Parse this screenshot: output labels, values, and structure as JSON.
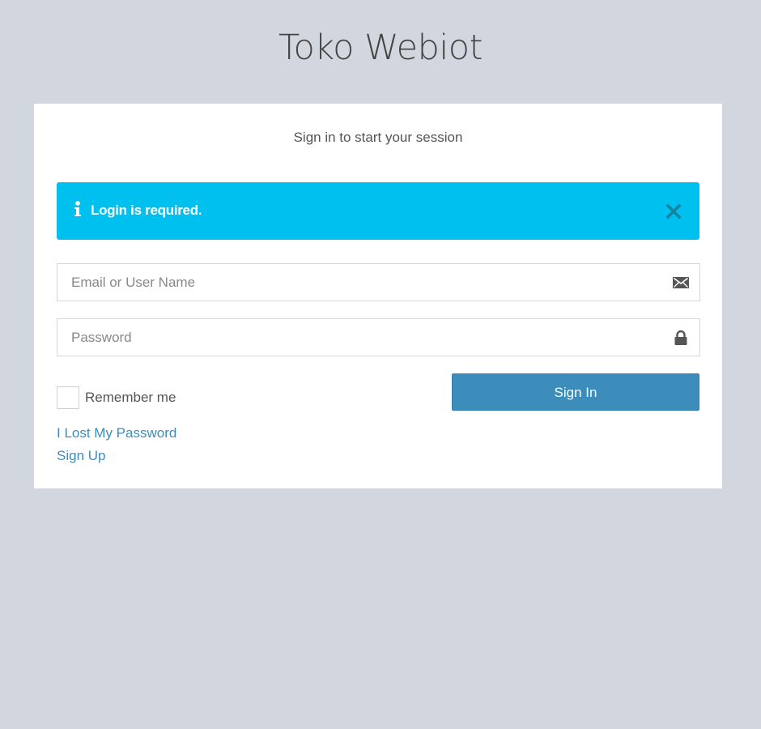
{
  "app": {
    "title": "Toko Webiot"
  },
  "login_box": {
    "message": "Sign in to start your session",
    "alert": {
      "text": "Login is required.",
      "icon": "info-icon",
      "close_icon": "close-icon",
      "color": "#00c0ef"
    },
    "email_field": {
      "placeholder": "Email or User Name",
      "value": "",
      "icon": "envelope-icon"
    },
    "password_field": {
      "placeholder": "Password",
      "value": "",
      "icon": "lock-icon"
    },
    "remember_me": {
      "label": "Remember me",
      "checked": false
    },
    "signin_button": {
      "label": "Sign In",
      "color": "#3c8dbc"
    },
    "links": {
      "lost_password": "I Lost My Password",
      "sign_up": "Sign Up"
    }
  },
  "colors": {
    "background": "#d2d6de",
    "link": "#3c8dbc"
  }
}
